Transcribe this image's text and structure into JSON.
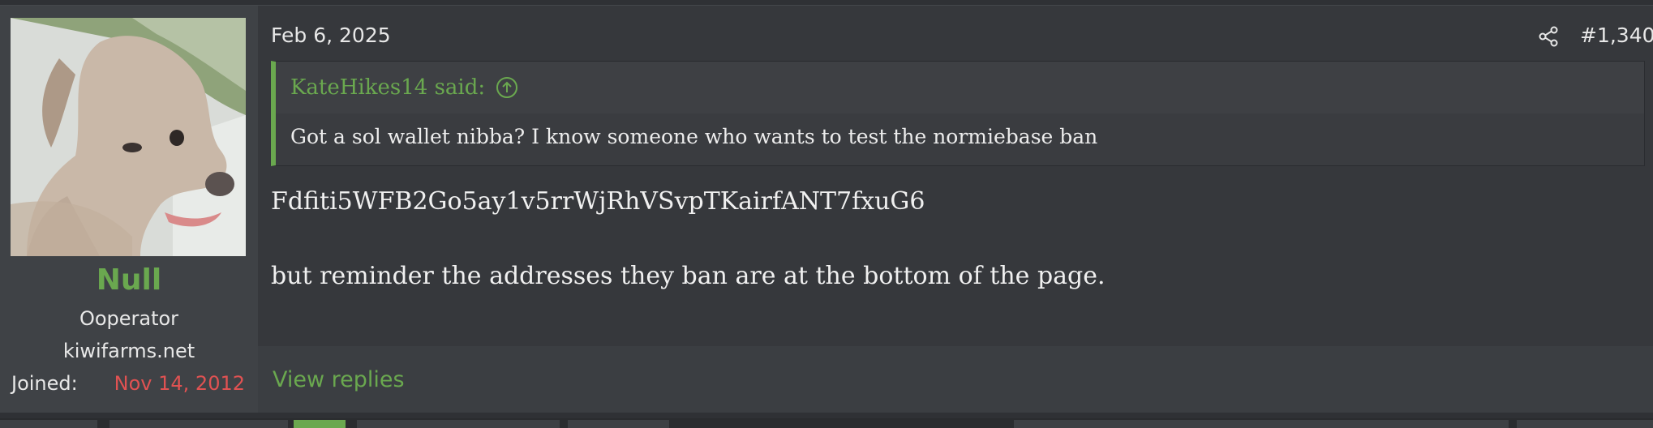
{
  "post": {
    "date": "Feb 6, 2025",
    "number": "#1,340",
    "share_icon": "share-icon",
    "author": {
      "name": "Null",
      "name_color": "#6aa84f",
      "title": "Ooperator",
      "banner": "kiwifarms.net",
      "joined_label": "Joined:",
      "joined_value": "Nov 14, 2012",
      "joined_color": "#e05252"
    },
    "quote": {
      "author_line": "KateHikes14 said:",
      "jump_icon": "arrow-up-circle-icon",
      "text": "Got a sol wallet nibba? I know someone who wants to test the normiebase ban"
    },
    "message": {
      "line1": "Fdfiti5WFB2Go5ay1v5rrWjRhVSvpTKairfANT7fxuG6",
      "line2": "but reminder the addresses they ban are at the bottom of the page."
    },
    "view_replies": "View replies"
  },
  "colors": {
    "accent": "#6aa84f",
    "background": "#36383c",
    "sidebar": "#3f4246"
  }
}
